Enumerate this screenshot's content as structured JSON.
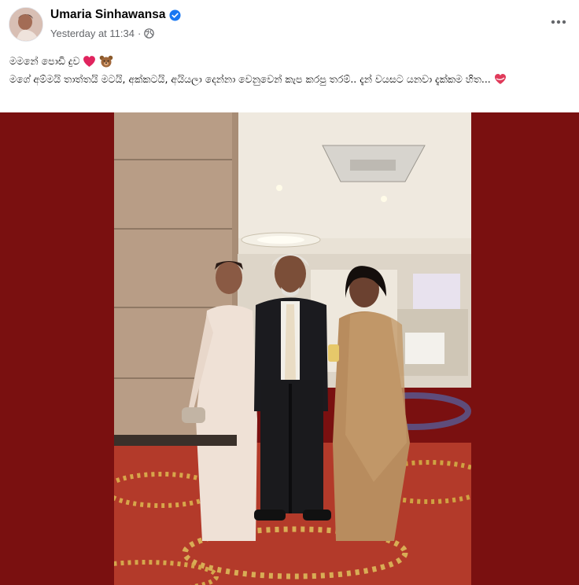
{
  "post": {
    "author_name": "Umaria Sinhawansa",
    "timestamp": "Yesterday at 11:34",
    "separator": "·",
    "privacy_icon": "globe-icon",
    "verified_icon": "verified-badge-icon",
    "more_icon": "more-options-icon",
    "caption_line1": "මමනේ පොඩි දුව",
    "caption_line1_emojis": [
      "red-heart-emoji",
      "bear-emoji"
    ],
    "caption_line2": "මගේ අම්මයි තාත්තයි මටයි, අක්කටයි, අයියලා දෙන්නා වෙනුවෙන් කැප කරපු තරම්.. දැන් වයසට යනවා දැක්කම හිත...",
    "caption_line2_emoji": "heart-with-ribbon-emoji"
  },
  "colors": {
    "photo_background": "#7a1010",
    "verified_blue": "#1877f2",
    "meta_gray": "#65676b"
  }
}
